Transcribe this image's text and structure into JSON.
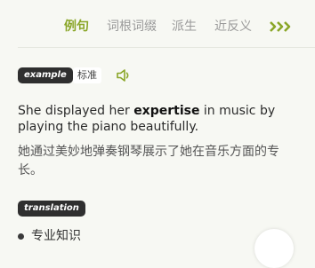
{
  "tabs": [
    {
      "label": "例句",
      "active": true
    },
    {
      "label": "词根词缀",
      "active": false
    },
    {
      "label": "派生",
      "active": false
    },
    {
      "label": "近反义",
      "active": false
    }
  ],
  "more_icon": "triple-chevron-right-icon",
  "example": {
    "badge": "example",
    "tag": "标准",
    "speaker_icon": "speaker-icon",
    "sentence_before": "She displayed her ",
    "sentence_keyword": "expertise",
    "sentence_after": " in music by playing the piano beautifully.",
    "translation": "她通过美妙地弹奏钢琴展示了她在音乐方面的专长。"
  },
  "translation_section": {
    "badge": "translation",
    "items": [
      "专业知识"
    ]
  },
  "colors": {
    "accent": "#8aa628",
    "background": "#f7f8f3",
    "badge_bg": "#2f2f2f"
  }
}
